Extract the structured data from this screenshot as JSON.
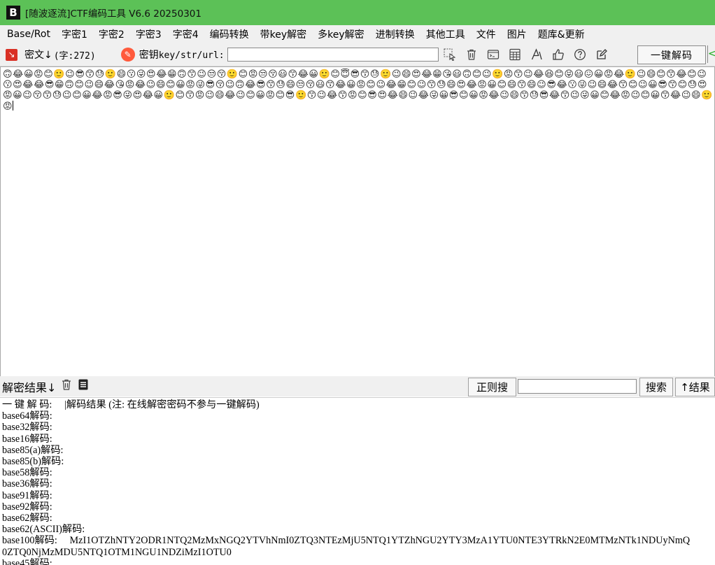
{
  "window": {
    "logo_text": "B",
    "title": "[随波逐流]CTF编码工具 V6.6 20250301"
  },
  "menu": [
    "Base/Rot",
    "字密1",
    "字密2",
    "字密3",
    "字密4",
    "编码转换",
    "带key解密",
    "多key解密",
    "进制转换",
    "其他工具",
    "文件",
    "图片",
    "题库&更新"
  ],
  "toolbar": {
    "cipher_label": "密文↓",
    "char_count": "(字:272)",
    "key_label_cn": "密钥",
    "key_label_en": "key/str/url:",
    "key_value": "",
    "tool_icons": [
      "cursor-select-icon",
      "trash-icon",
      "terminal-icon",
      "calculator-icon",
      "font-icon",
      "thumbs-up-icon",
      "help-icon",
      "edit-icon"
    ],
    "onekey_label": "一键解码",
    "arrow_label": "<"
  },
  "cipher": {
    "text": "🙃😂😀😡😊🙂😉😎😙😓🙂😄😗😜😍😂😁🙃😙😉😒😚🙂😊😡😒😚😃😙😂😀🙂😊😇😎😙😓🙂😉😄😍😂😁😘😃🙃😊😉🙂😡😙😉😂😆😊😝😃😖😀😡😂🙂😉😄😊😙😂😊😉😗😍😂😂😎😁🙃😊😉😄😂😘😡😂😉😄😊😀😡😜😎😚😉🙃😂😎😙😓😄😒😚😃😙😂😀😡😊😉😂😁😊😉😙😓😄😍😂😡😀😊😄😙😄😉😎😂😗😜😉😄😂😙😊😉😀😎😙😊😓😍😡😀😉😚😙😓😉😊😀😂😡😎😜😍😂😀🙂😊😙😡😉😄😂😉😊😀😡😊😎🙂😙😉😂😙😡😊😎😍😂😄😉😂😜😀😎😊😀😡😂😉😄😙😓😎😂😙😉😜😀😊😂😡😉😊😀😙😂😉😄🙂😡"
  },
  "result_bar": {
    "label": "解密结果↓",
    "icons": [
      "trash-icon",
      "notes-icon"
    ],
    "regex_label": "正则搜",
    "search_value": "",
    "search_label": "搜索",
    "up_label": "↑结果"
  },
  "results": [
    {
      "label": "一 键 解 码:",
      "value": "|解码结果 (注: 在线解密密码不参与一键解码)"
    },
    {
      "label": "base64解码:",
      "value": ""
    },
    {
      "label": "base32解码:",
      "value": ""
    },
    {
      "label": "base16解码:",
      "value": ""
    },
    {
      "label": "base85(a)解码:",
      "value": ""
    },
    {
      "label": "base85(b)解码:",
      "value": ""
    },
    {
      "label": "base58解码:",
      "value": ""
    },
    {
      "label": "base36解码:",
      "value": ""
    },
    {
      "label": "base91解码:",
      "value": ""
    },
    {
      "label": "base92解码:",
      "value": ""
    },
    {
      "label": "base62解码:",
      "value": ""
    },
    {
      "label": "base62(ASCII)解码:",
      "value": ""
    },
    {
      "label": "base100解码:",
      "value": "MzI1OTZhNTY2ODR1NTQ2MzMxNGQ2YTVhNmI0ZTQ3NTEzMjU5NTQ1YTZhNGU2YTY3MzA1YTU0NTE3YTRkN2E0MTMzNTk1NDUyNmQ"
    },
    {
      "label": "",
      "value": "0ZTQ0NjMzMDU5NTQ1OTM1NGU1NDZiMzI1OTU0"
    },
    {
      "label": "base45解码:",
      "value": ""
    }
  ]
}
